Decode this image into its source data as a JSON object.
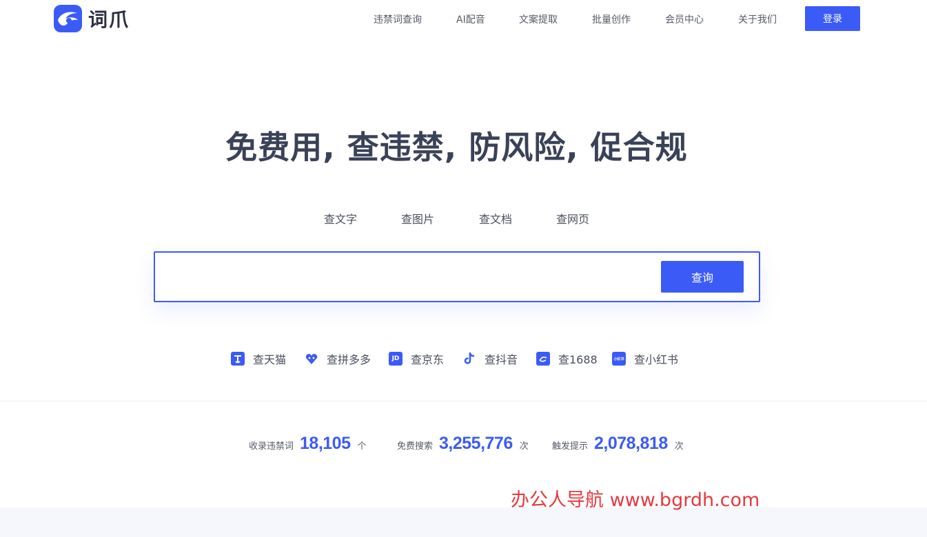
{
  "brand": {
    "name": "词爪",
    "accent_color": "#3b5bf6"
  },
  "nav": {
    "items": [
      {
        "label": "违禁词查询"
      },
      {
        "label": "AI配音"
      },
      {
        "label": "文案提取"
      },
      {
        "label": "批量创作"
      },
      {
        "label": "会员中心"
      },
      {
        "label": "关于我们"
      }
    ],
    "login_label": "登录"
  },
  "hero": {
    "title": "免费用, 查违禁, 防风险, 促合规"
  },
  "tabs": [
    {
      "label": "查文字"
    },
    {
      "label": "查图片"
    },
    {
      "label": "查文档"
    },
    {
      "label": "查网页"
    }
  ],
  "search": {
    "value": "",
    "button_label": "查询"
  },
  "platforms": [
    {
      "label": "查天猫",
      "icon": "tmall-icon"
    },
    {
      "label": "查拼多多",
      "icon": "pinduoduo-icon"
    },
    {
      "label": "查京东",
      "icon": "jd-icon",
      "icon_text": "JD"
    },
    {
      "label": "查抖音",
      "icon": "douyin-icon"
    },
    {
      "label": "查1688",
      "icon": "1688-icon"
    },
    {
      "label": "查小红书",
      "icon": "xiaohongshu-icon",
      "icon_text": "小红书"
    }
  ],
  "stats": [
    {
      "label": "收录违禁词",
      "value": "18,105",
      "unit": "个"
    },
    {
      "label": "免费搜索",
      "value": "3,255,776",
      "unit": "次"
    },
    {
      "label": "触发提示",
      "value": "2,078,818",
      "unit": "次"
    }
  ],
  "watermark": {
    "text": "办公人导航 www.bgrdh.com",
    "color": "#e8383d"
  }
}
